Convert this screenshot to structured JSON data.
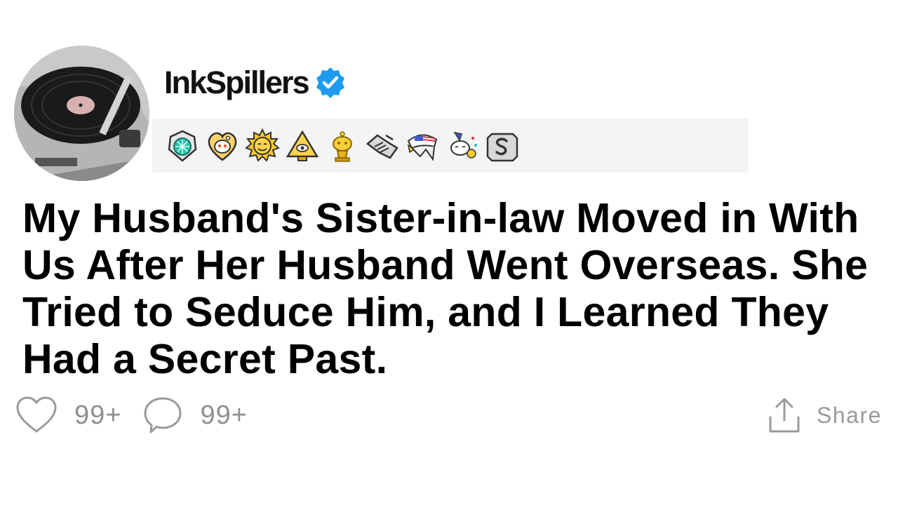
{
  "post": {
    "author": "InkSpillers",
    "verified_icon": "verified-check-icon",
    "title": "My Husband's Sister-in-law Moved in With Us After Her Husband Went Overseas. She Tried to Seduce Him, and I Learned They Had a Secret Past.",
    "awards": [
      "teal-gem-award-icon",
      "heart-snoo-award-icon",
      "sun-face-award-icon",
      "pyramid-eye-award-icon",
      "gold-snoo-trophy-award-icon",
      "handshake-award-icon",
      "eagle-flag-award-icon",
      "snoo-party-award-icon",
      "silver-s-award-icon"
    ]
  },
  "actions": {
    "likes": "99+",
    "comments": "99+",
    "share_label": "Share"
  },
  "colors": {
    "verified_blue": "#1d9bf0",
    "muted_gray": "#8f8f8f",
    "award_bar_bg": "#f4f4f4"
  }
}
